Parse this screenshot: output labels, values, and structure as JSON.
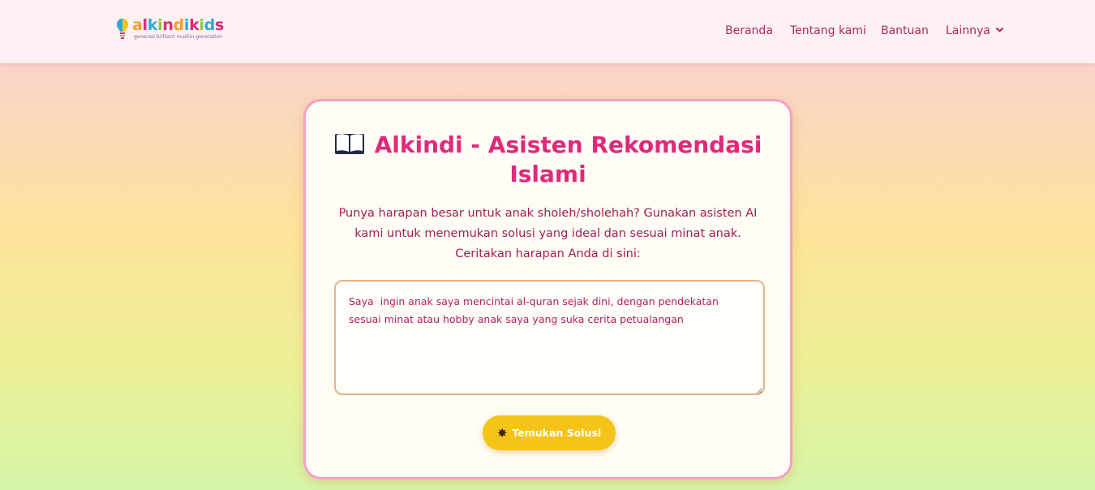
{
  "brand": {
    "name": "alkindikids",
    "tagline": "generasi brilliant muslim generation",
    "letter_colors": [
      "#f2a12a",
      "#e0297a",
      "#2aa9e0",
      "#8cc63f",
      "#e0297a",
      "#f2a12a",
      "#2aa9e0",
      "#e0297a",
      "#8cc63f",
      "#2aa9e0",
      "#e0297a"
    ]
  },
  "nav": {
    "items": [
      {
        "label": "Beranda"
      },
      {
        "label": "Tentang kami"
      },
      {
        "label": "Bantuan"
      },
      {
        "label": "Lainnya"
      }
    ]
  },
  "card": {
    "title": "Alkindi - Asisten Rekomendasi Islami",
    "description": "Punya harapan besar untuk anak sholeh/sholehah? Gunakan asisten AI kami untuk menemukan solusi yang ideal dan sesuai minat anak. Ceritakan harapan Anda di sini:",
    "input_value": "Saya  ingin anak saya mencintai al-quran sejak dini, dengan pendekatan sesuai minat atau hobby anak saya yang suka cerita petualangan",
    "button_label": "Temukan Solusi"
  },
  "colors": {
    "accent": "#e0297a",
    "nav_text": "#b0275e",
    "button": "#f6c419",
    "card_border": "#f3a1c4"
  },
  "icons": {
    "logo": "lightbulb-icon",
    "title": "open-book-icon",
    "button": "sparkle-icon",
    "dropdown": "chevron-down-icon"
  }
}
